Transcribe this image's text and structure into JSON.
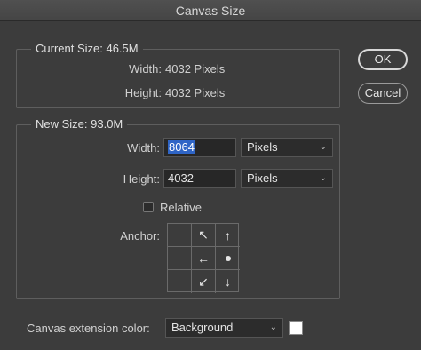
{
  "window": {
    "title": "Canvas Size"
  },
  "current_size": {
    "title": "Current Size: 46.5M",
    "width_label": "Width:",
    "width_value": "4032 Pixels",
    "height_label": "Height:",
    "height_value": "4032 Pixels"
  },
  "new_size": {
    "title": "New Size: 93.0M",
    "width_label": "Width:",
    "width_value": "8064",
    "width_unit": "Pixels",
    "height_label": "Height:",
    "height_value": "4032",
    "height_unit": "Pixels",
    "relative_label": "Relative",
    "relative_checked": false,
    "anchor_label": "Anchor:",
    "anchor_glyphs": [
      "",
      "↖",
      "↑",
      "",
      "←",
      "●",
      "",
      "↙",
      "↓"
    ]
  },
  "buttons": {
    "ok": "OK",
    "cancel": "Cancel"
  },
  "extension": {
    "label": "Canvas extension color:",
    "value": "Background",
    "swatch_color": "#ffffff"
  },
  "colors": {
    "background": "#3c3c3c",
    "selection": "#2f65c6"
  }
}
